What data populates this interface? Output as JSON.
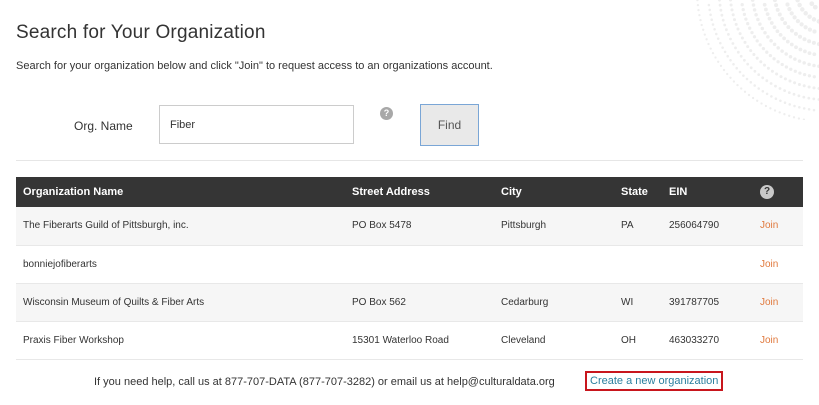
{
  "page": {
    "title": "Search for Your Organization",
    "intro": "Search for your organization below and click \"Join\" to request access to an organizations account."
  },
  "search": {
    "label": "Org. Name",
    "value": "Fiber",
    "help_glyph": "?",
    "find_label": "Find"
  },
  "table": {
    "headers": {
      "name": "Organization Name",
      "street": "Street Address",
      "city": "City",
      "state": "State",
      "ein": "EIN",
      "help_glyph": "?"
    },
    "rows": [
      {
        "name": "The Fiberarts Guild of Pittsburgh, inc.",
        "street": "PO Box 5478",
        "city": "Pittsburgh",
        "state": "PA",
        "ein": "256064790",
        "action": "Join"
      },
      {
        "name": "bonniejofiberarts",
        "street": "",
        "city": "",
        "state": "",
        "ein": "",
        "action": "Join"
      },
      {
        "name": "Wisconsin Museum of Quilts & Fiber Arts",
        "street": "PO Box 562",
        "city": "Cedarburg",
        "state": "WI",
        "ein": "391787705",
        "action": "Join"
      },
      {
        "name": "Praxis Fiber Workshop",
        "street": "15301 Waterloo Road",
        "city": "Cleveland",
        "state": "OH",
        "ein": "463033270",
        "action": "Join"
      }
    ]
  },
  "footer": {
    "help_text": "If you need help, call us at 877-707-DATA (877-707-3282) or email us at help@culturaldata.org",
    "create_link": "Create a new organization"
  },
  "colors": {
    "header_bg": "#353535",
    "join_link": "#e0793d",
    "create_link": "#2a7f9e",
    "highlight_border": "#c8161d",
    "find_border": "#7aa6d6"
  },
  "icons": {
    "help": "question-circle-icon",
    "decoration": "dot-pattern-icon"
  }
}
